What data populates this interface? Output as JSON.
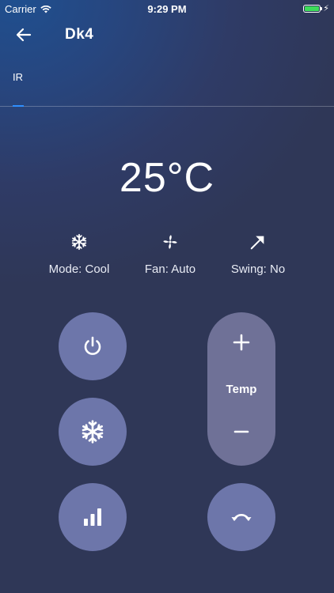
{
  "status_bar": {
    "carrier": "Carrier",
    "time": "9:29 PM",
    "battery_level": 1.0,
    "battery_color": "#3ddc5a"
  },
  "header": {
    "title": "Dk4",
    "back_icon": "arrow-left-icon"
  },
  "tabs": [
    {
      "label": "IR",
      "active": true
    }
  ],
  "accent_color": "#2f8fff",
  "ac": {
    "temperature": "25°C",
    "mode": {
      "label": "Mode: Cool",
      "icon": "snowflake-icon"
    },
    "fan": {
      "label": "Fan: Auto",
      "icon": "fan-icon"
    },
    "swing": {
      "label": "Swing: No",
      "icon": "swing-icon"
    }
  },
  "controls": {
    "power_icon": "power-icon",
    "mode_icon": "snowflake-icon",
    "fan_speed_icon": "signal-bars-icon",
    "temp_label": "Temp",
    "temp_up_icon": "plus-icon",
    "temp_down_icon": "minus-icon",
    "swing_icon": "rotate-icon"
  },
  "colors": {
    "button_fill": "#6d76aa",
    "pill_fill": "#6f7197"
  }
}
